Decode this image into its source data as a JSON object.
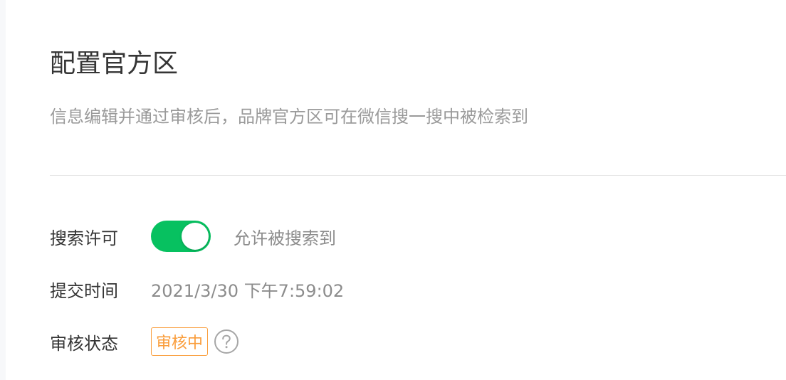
{
  "header": {
    "title": "配置官方区",
    "description": "信息编辑并通过审核后，品牌官方区可在微信搜一搜中被检索到"
  },
  "settings": {
    "search_permission": {
      "label": "搜索许可",
      "enabled": true,
      "toggle_description": "允许被搜索到"
    },
    "submit_time": {
      "label": "提交时间",
      "value": "2021/3/30 下午7:59:02"
    },
    "review_status": {
      "label": "审核状态",
      "badge": "审核中",
      "help_icon": "question-circle-icon"
    }
  },
  "colors": {
    "toggle_on": "#07c160",
    "badge": "#fa9d3b",
    "secondary_text": "#9a9a9a"
  }
}
